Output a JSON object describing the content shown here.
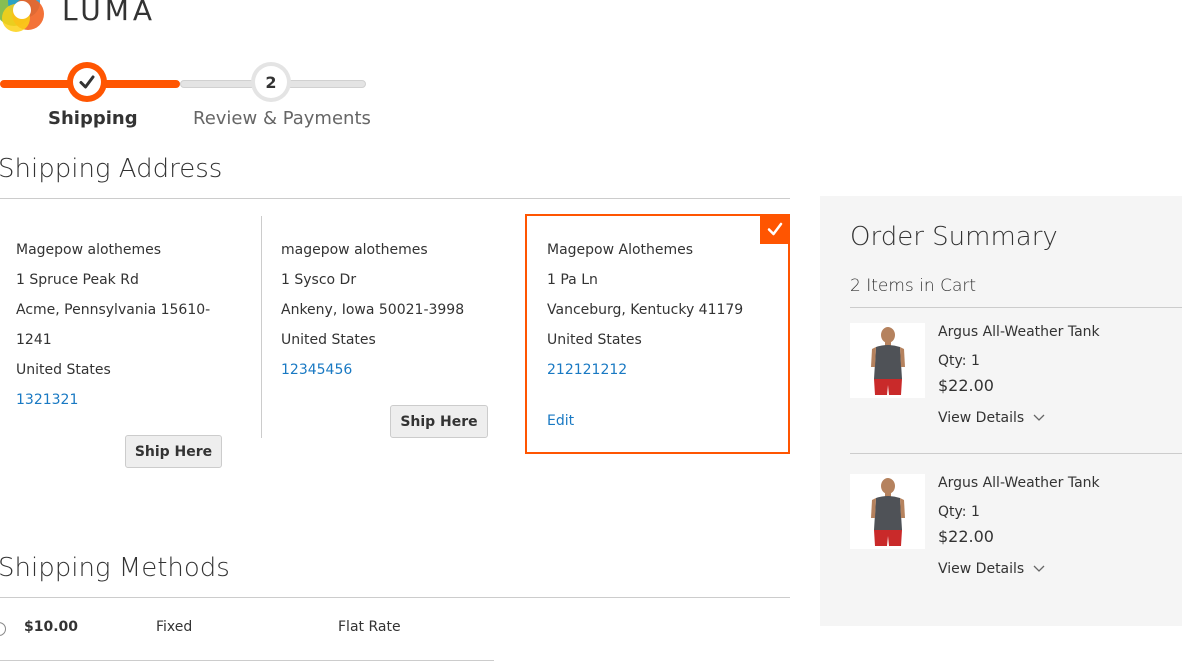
{
  "brand": {
    "name": "LUMA"
  },
  "progress": {
    "steps": [
      {
        "number": "1",
        "label": "Shipping",
        "state": "complete"
      },
      {
        "number": "2",
        "label": "Review & Payments",
        "state": "pending"
      }
    ],
    "accent_color": "#ff5501"
  },
  "shipping_address": {
    "title": "Shipping Address",
    "addresses": [
      {
        "name": "Magepow alothemes",
        "street": "1 Spruce Peak Rd",
        "city_line_1": "Acme, Pennsylvania 15610-",
        "city_line_2": "1241",
        "country": "United States",
        "phone": "1321321",
        "action": "Ship Here"
      },
      {
        "name": "magepow alothemes",
        "street": "1 Sysco Dr",
        "city_line_1": "Ankeny, Iowa 50021-3998",
        "country": "United States",
        "phone": "12345456",
        "action": "Ship Here"
      },
      {
        "name": "Magepow Alothemes",
        "street": "1 Pa Ln",
        "city_line_1": "Vanceburg, Kentucky 41179",
        "country": "United States",
        "phone": "212121212",
        "action": "Edit",
        "selected": true
      }
    ]
  },
  "shipping_methods": {
    "title": "Shipping Methods",
    "rows": [
      {
        "price": "$10.00",
        "method": "Fixed",
        "carrier": "Flat Rate"
      }
    ]
  },
  "order_summary": {
    "title": "Order Summary",
    "items_count": "2 Items in Cart",
    "items": [
      {
        "name": "Argus All-Weather Tank",
        "qty": "Qty: 1",
        "price": "$22.00",
        "details_label": "View Details"
      },
      {
        "name": "Argus All-Weather Tank",
        "qty": "Qty: 1",
        "price": "$22.00",
        "details_label": "View Details"
      }
    ]
  }
}
